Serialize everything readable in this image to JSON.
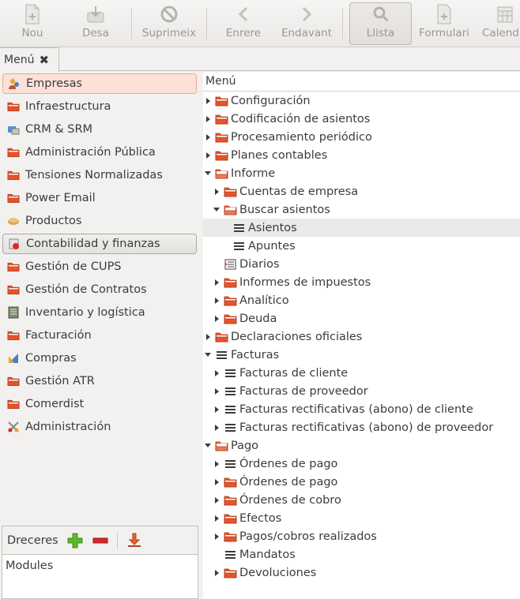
{
  "toolbar": {
    "buttons": [
      {
        "label": "Nou",
        "icon": "new-document-icon"
      },
      {
        "label": "Desa",
        "icon": "save-icon"
      },
      {
        "label": "Suprimeix",
        "icon": "delete-icon"
      },
      {
        "label": "Enrere",
        "icon": "back-arrow-icon"
      },
      {
        "label": "Endavant",
        "icon": "forward-arrow-icon"
      },
      {
        "label": "Llista",
        "icon": "search-icon"
      },
      {
        "label": "Formulari",
        "icon": "form-icon"
      },
      {
        "label": "Calend",
        "icon": "calendar-icon"
      }
    ]
  },
  "tabs": {
    "menu_label": "Menú",
    "close_glyph": "✖"
  },
  "modules": [
    {
      "label": "Empresas",
      "icon": "companies-icon",
      "state": "active"
    },
    {
      "label": "Infraestructura",
      "icon": "folder-icon"
    },
    {
      "label": "CRM & SRM",
      "icon": "crm-icon"
    },
    {
      "label": "Administración Pública",
      "icon": "folder-icon"
    },
    {
      "label": "Tensiones Normalizadas",
      "icon": "folder-icon"
    },
    {
      "label": "Power Email",
      "icon": "folder-icon"
    },
    {
      "label": "Productos",
      "icon": "products-icon"
    },
    {
      "label": "Contabilidad y finanzas",
      "icon": "accounting-icon",
      "state": "selected"
    },
    {
      "label": "Gestión de CUPS",
      "icon": "folder-icon"
    },
    {
      "label": "Gestión de Contratos",
      "icon": "folder-icon"
    },
    {
      "label": "Inventario y logística",
      "icon": "inventory-icon"
    },
    {
      "label": "Facturación",
      "icon": "folder-icon"
    },
    {
      "label": "Compras",
      "icon": "purchases-icon"
    },
    {
      "label": "Gestión ATR",
      "icon": "folder-icon"
    },
    {
      "label": "Comerdist",
      "icon": "folder-icon"
    },
    {
      "label": "Administración",
      "icon": "administration-icon"
    }
  ],
  "shortcuts": {
    "title": "Dreceres",
    "modules_label": "Modules"
  },
  "tree": {
    "header": "Menú",
    "rows": [
      {
        "label": "Configuración",
        "level": 0,
        "expander": "collapsed",
        "icon": "folder"
      },
      {
        "label": "Codificación de asientos",
        "level": 0,
        "expander": "collapsed",
        "icon": "folder"
      },
      {
        "label": "Procesamiento periódico",
        "level": 0,
        "expander": "collapsed",
        "icon": "folder"
      },
      {
        "label": "Planes contables",
        "level": 0,
        "expander": "collapsed",
        "icon": "folder"
      },
      {
        "label": "Informe",
        "level": 0,
        "expander": "expanded",
        "icon": "folder-open"
      },
      {
        "label": "Cuentas de empresa",
        "level": 1,
        "expander": "collapsed",
        "icon": "folder"
      },
      {
        "label": "Buscar asientos",
        "level": 1,
        "expander": "expanded",
        "icon": "folder-open"
      },
      {
        "label": "Asientos",
        "level": 2,
        "expander": "none",
        "icon": "list",
        "highlight": true
      },
      {
        "label": "Apuntes",
        "level": 2,
        "expander": "none",
        "icon": "list"
      },
      {
        "label": "Diarios",
        "level": 1,
        "expander": "none",
        "icon": "journal"
      },
      {
        "label": "Informes de impuestos",
        "level": 1,
        "expander": "collapsed",
        "icon": "folder"
      },
      {
        "label": "Analítico",
        "level": 1,
        "expander": "collapsed",
        "icon": "folder"
      },
      {
        "label": "Deuda",
        "level": 1,
        "expander": "collapsed",
        "icon": "folder"
      },
      {
        "label": "Declaraciones oficiales",
        "level": 0,
        "expander": "collapsed",
        "icon": "folder"
      },
      {
        "label": "Facturas",
        "level": 0,
        "expander": "expanded",
        "icon": "list"
      },
      {
        "label": "Facturas de cliente",
        "level": 1,
        "expander": "collapsed",
        "icon": "list"
      },
      {
        "label": "Facturas de proveedor",
        "level": 1,
        "expander": "collapsed",
        "icon": "list"
      },
      {
        "label": "Facturas rectificativas (abono) de cliente",
        "level": 1,
        "expander": "collapsed",
        "icon": "list"
      },
      {
        "label": "Facturas rectificativas (abono) de proveedor",
        "level": 1,
        "expander": "collapsed",
        "icon": "list"
      },
      {
        "label": "Pago",
        "level": 0,
        "expander": "expanded",
        "icon": "folder-open"
      },
      {
        "label": "Órdenes de pago",
        "level": 1,
        "expander": "collapsed",
        "icon": "list"
      },
      {
        "label": "Órdenes de pago",
        "level": 1,
        "expander": "collapsed",
        "icon": "folder"
      },
      {
        "label": "Órdenes de cobro",
        "level": 1,
        "expander": "collapsed",
        "icon": "folder"
      },
      {
        "label": "Efectos",
        "level": 1,
        "expander": "collapsed",
        "icon": "folder"
      },
      {
        "label": "Pagos/cobros realizados",
        "level": 1,
        "expander": "collapsed",
        "icon": "folder"
      },
      {
        "label": "Mandatos",
        "level": 1,
        "expander": "none",
        "icon": "list"
      },
      {
        "label": "Devoluciones",
        "level": 1,
        "expander": "collapsed",
        "icon": "folder"
      }
    ]
  },
  "colors": {
    "folder_orange": "#e8532a",
    "active_bg": "#fbe1d8",
    "active_border": "#efa78c",
    "highlight_row": "#ebeae8",
    "plus_green": "#5cb82d",
    "minus_red": "#d9262a"
  }
}
